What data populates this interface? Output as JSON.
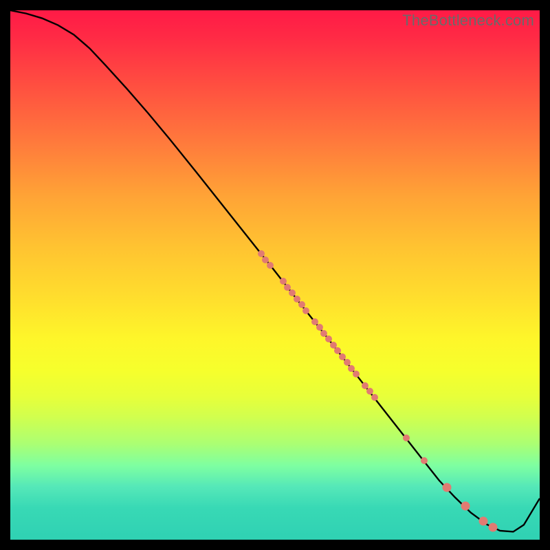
{
  "watermark": "TheBottleneck.com",
  "colors": {
    "dot": "#e17b72",
    "line": "#000000",
    "frame": "#000000"
  },
  "chart_data": {
    "type": "line",
    "title": "",
    "xlabel": "",
    "ylabel": "",
    "xlim": [
      0,
      100
    ],
    "ylim": [
      0,
      100
    ],
    "curve": {
      "x": [
        0,
        3,
        6,
        9,
        12,
        15,
        18,
        22,
        26,
        30,
        35,
        40,
        45,
        50,
        55,
        60,
        65,
        70,
        74,
        78,
        81,
        84,
        87,
        90,
        92.5,
        95,
        97,
        100
      ],
      "y": [
        100,
        99.4,
        98.5,
        97.2,
        95.4,
        92.8,
        89.6,
        85.2,
        80.6,
        75.8,
        69.6,
        63.3,
        57,
        50.7,
        44.3,
        38,
        31.6,
        25.2,
        20.1,
        15,
        11.2,
        8,
        5.1,
        2.9,
        1.7,
        1.5,
        2.8,
        7.8
      ]
    },
    "scatter": {
      "x": [
        47.4,
        48.2,
        49.1,
        51.5,
        52.4,
        53.2,
        54.1,
        55.0,
        55.8,
        57.5,
        58.4,
        59.2,
        60.1,
        61.0,
        61.8,
        62.7,
        63.6,
        64.4,
        65.3,
        67.0,
        67.9,
        68.8,
        74.8,
        78.2,
        82.5,
        86.0,
        89.4,
        91.2
      ],
      "y": [
        54.0,
        52.9,
        51.8,
        48.8,
        47.7,
        46.6,
        45.5,
        44.4,
        43.3,
        41.2,
        40.1,
        39.0,
        37.9,
        36.8,
        35.7,
        34.6,
        33.5,
        32.4,
        31.3,
        29.1,
        28.0,
        26.9,
        19.2,
        14.9,
        9.9,
        6.3,
        3.5,
        2.4
      ],
      "size": [
        10,
        10,
        10,
        10,
        10,
        10,
        10,
        10,
        10,
        10,
        10,
        10,
        10,
        10,
        10,
        10,
        10,
        10,
        10,
        10,
        10,
        10,
        10,
        10,
        13,
        13,
        13,
        13
      ]
    }
  }
}
